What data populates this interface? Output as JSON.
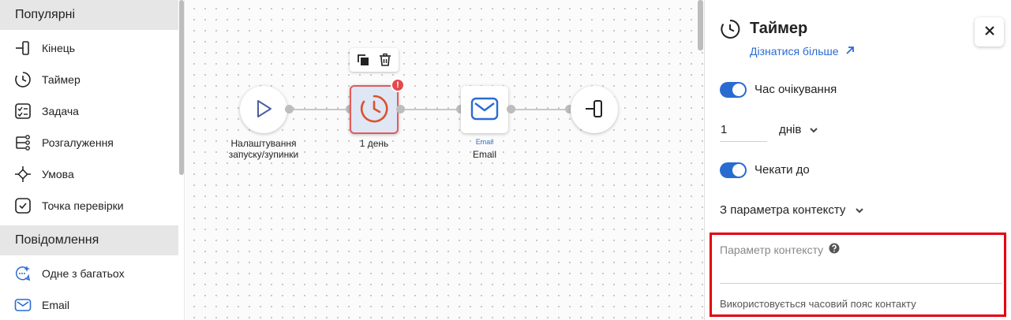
{
  "sidebar": {
    "sections": [
      {
        "title": "Популярні",
        "items": [
          {
            "label": "Кінець",
            "icon": "end-icon"
          },
          {
            "label": "Таймер",
            "icon": "timer-icon"
          },
          {
            "label": "Задача",
            "icon": "task-icon"
          },
          {
            "label": "Розгалуження",
            "icon": "branch-icon"
          },
          {
            "label": "Умова",
            "icon": "condition-icon"
          },
          {
            "label": "Точка перевірки",
            "icon": "checkpoint-icon"
          }
        ]
      },
      {
        "title": "Повідомлення",
        "items": [
          {
            "label": "Одне з багатьох",
            "icon": "one-of-many-icon"
          },
          {
            "label": "Email",
            "icon": "email-icon"
          }
        ]
      }
    ]
  },
  "canvas": {
    "nodes": {
      "start": {
        "label_line1": "Налаштування",
        "label_line2": "запуску/зупинки",
        "icon": "play-icon"
      },
      "timer": {
        "label": "1 день",
        "icon": "timer-icon",
        "badge": "!",
        "selected": true
      },
      "email": {
        "sublabel": "Email",
        "label": "Email",
        "icon": "email-icon"
      },
      "end": {
        "icon": "end-icon"
      }
    },
    "toolbar": {
      "icons": [
        "copy-icon",
        "trash-icon"
      ]
    }
  },
  "panel": {
    "title": "Таймер",
    "learn_more": "Дізнатися більше",
    "wait_time": {
      "label": "Час очікування",
      "enabled": true
    },
    "duration": {
      "value": "1",
      "unit": "днів"
    },
    "wait_until": {
      "label": "Чекати до",
      "enabled": true
    },
    "source_select": {
      "value": "З параметра контексту"
    },
    "context_param": {
      "label": "Параметр контексту",
      "value": "",
      "hint": "Використовується часовий пояс контакту"
    }
  },
  "colors": {
    "accent": "#2a6bd1",
    "error": "#e5484d",
    "highlight": "#e3000f",
    "timer_orange": "#d9532a"
  }
}
